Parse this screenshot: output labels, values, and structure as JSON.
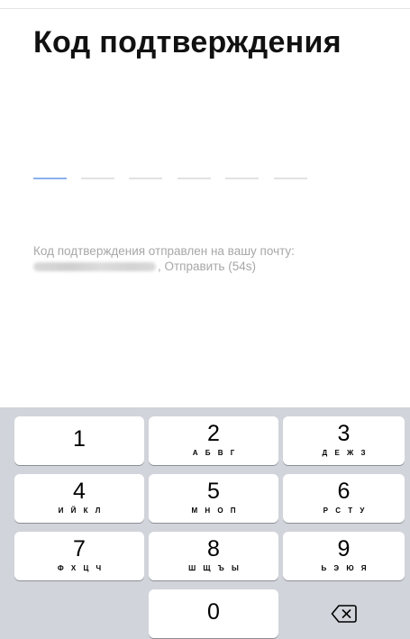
{
  "screen": {
    "title": "Код подтверждения"
  },
  "code_input": {
    "length": 6,
    "active_index": 0
  },
  "info": {
    "message": "Код подтверждения отправлен на вашу почту:",
    "resend_text": ", Отправить (54s)"
  },
  "keypad": {
    "keys": [
      {
        "digit": "1",
        "letters": ""
      },
      {
        "digit": "2",
        "letters": "А Б В Г"
      },
      {
        "digit": "3",
        "letters": "Д Е Ж З"
      },
      {
        "digit": "4",
        "letters": "И Й К Л"
      },
      {
        "digit": "5",
        "letters": "М Н О П"
      },
      {
        "digit": "6",
        "letters": "Р С Т У"
      },
      {
        "digit": "7",
        "letters": "Ф Х Ц Ч"
      },
      {
        "digit": "8",
        "letters": "Ш Щ Ъ Ы"
      },
      {
        "digit": "9",
        "letters": "Ь Э Ю Я"
      },
      {
        "digit": "0",
        "letters": ""
      }
    ],
    "delete_icon": "backspace-icon"
  },
  "colors": {
    "active_slot": "#8ab1ef",
    "inactive_slot": "#e2e2e2",
    "keyboard_bg": "#d1d4da",
    "info_text": "#a7a7a7"
  }
}
